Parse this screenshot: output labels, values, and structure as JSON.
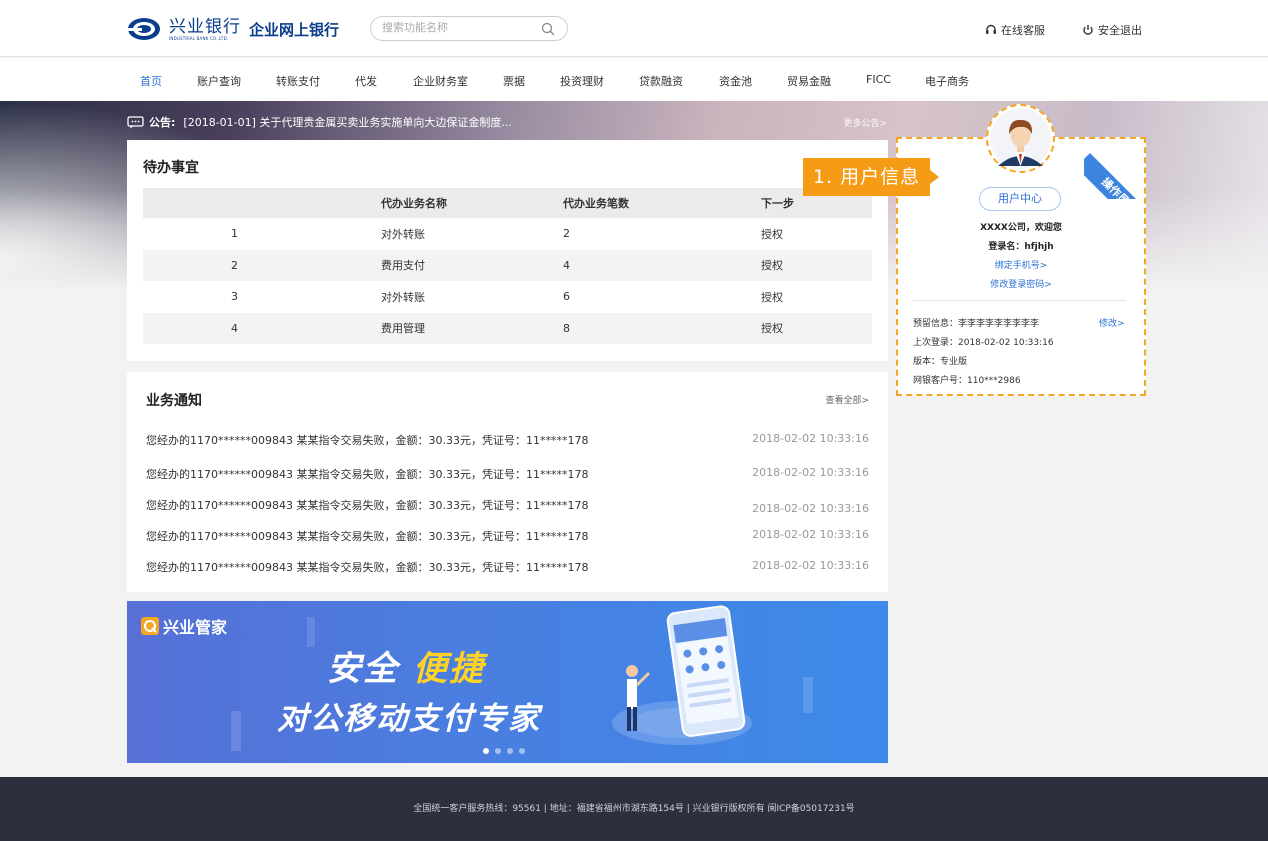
{
  "header": {
    "brand_cn": "兴业银行",
    "brand_en": "INDUSTRIAL BANK CO.,LTD.",
    "brand_sub": "企业网上银行",
    "search_placeholder": "搜索功能名称",
    "service_label": "在线客服",
    "logout_label": "安全退出"
  },
  "nav": {
    "items": [
      "首页",
      "账户查询",
      "转账支付",
      "代发",
      "企业财务室",
      "票据",
      "投资理财",
      "贷款融资",
      "资金池",
      "贸易金融",
      "FICC",
      "电子商务"
    ],
    "active_index": 0,
    "accent_color": "#2a6fd6"
  },
  "notice_bar": {
    "label": "公告:",
    "text": "[2018-01-01]  关于代理贵金属买卖业务实施单向大边保证金制度...",
    "more": "更多公告>"
  },
  "todo": {
    "title": "待办事宜",
    "columns": [
      "",
      "代办业务名称",
      "代办业务笔数",
      "下一步"
    ],
    "rows": [
      [
        "1",
        "对外转账",
        "2",
        "授权"
      ],
      [
        "2",
        "费用支付",
        "4",
        "授权"
      ],
      [
        "3",
        "对外转账",
        "6",
        "授权"
      ],
      [
        "4",
        "费用管理",
        "8",
        "授权"
      ]
    ]
  },
  "business_notices": {
    "title": "业务通知",
    "view_all": "查看全部>",
    "items": [
      {
        "text": "您经办的1170******009843 某某指令交易失败，金额：30.33元，凭证号：11*****178",
        "time": "2018-02-02   10:33:16"
      },
      {
        "text": "您经办的1170******009843 某某指令交易失败，金额：30.33元，凭证号：11*****178",
        "time": "2018-02-02   10:33:16"
      },
      {
        "text": "您经办的1170******009843 某某指令交易失败，金额：30.33元，凭证号：11*****178",
        "time": "2018-02-02   10:33:16"
      },
      {
        "text": "您经办的1170******009843 某某指令交易失败，金额：30.33元，凭证号：11*****178",
        "time": "2018-02-02   10:33:16"
      },
      {
        "text": "您经办的1170******009843 某某指令交易失败，金额：30.33元，凭证号：11*****178",
        "time": "2018-02-02   10:33:16"
      }
    ]
  },
  "promo": {
    "brand": "兴业管家",
    "line1_a": "安全",
    "line1_b": "便捷",
    "line2": "对公移动支付专家",
    "slide_count": 4,
    "active_slide": 0
  },
  "user_card": {
    "callout": "1. 用户信息",
    "role_badge": "操作员",
    "center_button": "用户中心",
    "welcome": "XXXX公司，欢迎您",
    "login_name": "登录名：hfjhjh",
    "bind_phone": "绑定手机号>",
    "change_password": "修改登录密码>",
    "reserved_info": "预留信息：李李李李李李李李李",
    "edit": "修改>",
    "last_login": "上次登录：2018-02-02 10:33:16",
    "version": "版本：专业版",
    "customer_no": "网银客户号：110***2986",
    "border_color": "#f5a623"
  },
  "footer": {
    "text": "全国统一客户服务热线：95561  |  地址：福建省福州市湖东路154号  |  兴业银行版权所有  闽ICP备05017231号"
  }
}
